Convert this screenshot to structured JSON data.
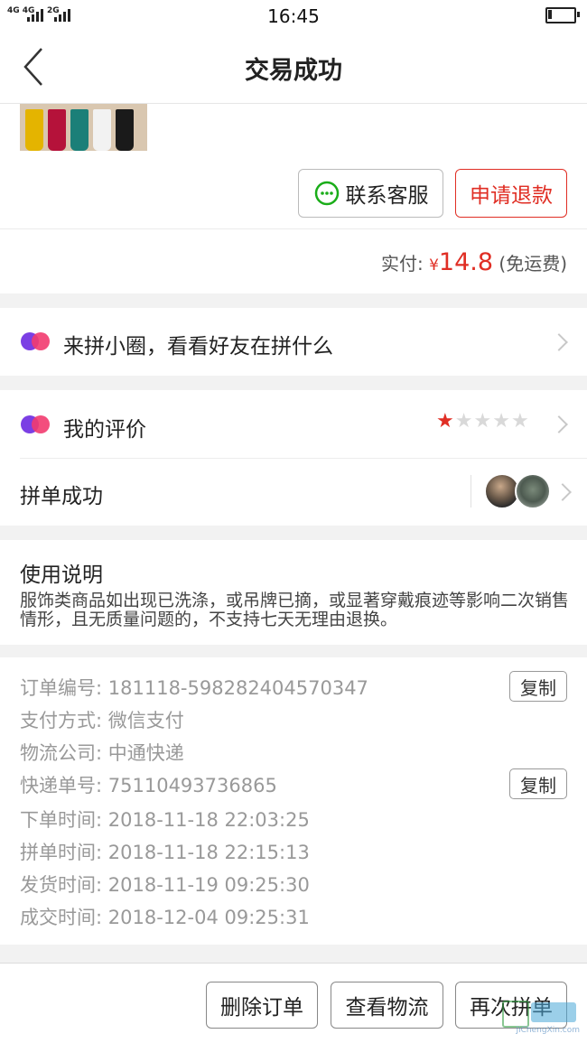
{
  "status_bar": {
    "network_1": "4G 4G",
    "network_2": "2G",
    "time": "16:45",
    "battery_percent": 15
  },
  "header": {
    "title": "交易成功"
  },
  "product": {
    "image_icon": "socks-product-image",
    "sock_colors": [
      "#e4b400",
      "#b5123a",
      "#1b7f78",
      "#f2f2f2",
      "#1a1a1a"
    ],
    "contact_service_label": "联系客服",
    "refund_label": "申请退款"
  },
  "payment": {
    "label": "实付:",
    "currency": "¥",
    "amount": "14.8",
    "note": "(免运费)"
  },
  "circle_row": {
    "label": "来拼小圈，看看好友在拼什么"
  },
  "review_row": {
    "label": "我的评价",
    "rating": 1,
    "max_rating": 5
  },
  "group_row": {
    "label": "拼单成功"
  },
  "instructions": {
    "title": "使用说明",
    "body": "服饰类商品如出现已洗涤，或吊牌已摘，或显著穿戴痕迹等影响二次销售情形，且无质量问题的，不支持七天无理由退换。"
  },
  "order_info": {
    "order_no": {
      "label": "订单编号:",
      "value": "181118-598282404570347",
      "copy": "复制"
    },
    "pay_method": {
      "label": "支付方式:",
      "value": "微信支付"
    },
    "logistics": {
      "label": "物流公司:",
      "value": "中通快递"
    },
    "tracking_no": {
      "label": "快递单号:",
      "value": "75110493736865",
      "copy": "复制"
    },
    "order_time": {
      "label": "下单时间:",
      "value": "2018-11-18 22:03:25"
    },
    "group_time": {
      "label": "拼单时间:",
      "value": "2018-11-18 22:15:13"
    },
    "ship_time": {
      "label": "发货时间:",
      "value": "2018-11-19 09:25:30"
    },
    "deal_time": {
      "label": "成交时间:",
      "value": "2018-12-04 09:25:31"
    }
  },
  "bottom_bar": {
    "delete_label": "删除订单",
    "logistics_label": "查看物流",
    "rebuy_label": "再次拼单"
  },
  "watermark": {
    "text": "JiChengXin.com"
  },
  "colors": {
    "accent_red": "#e02e24",
    "wechat_green": "#1aad19",
    "gap_gray": "#f2f2f2"
  }
}
